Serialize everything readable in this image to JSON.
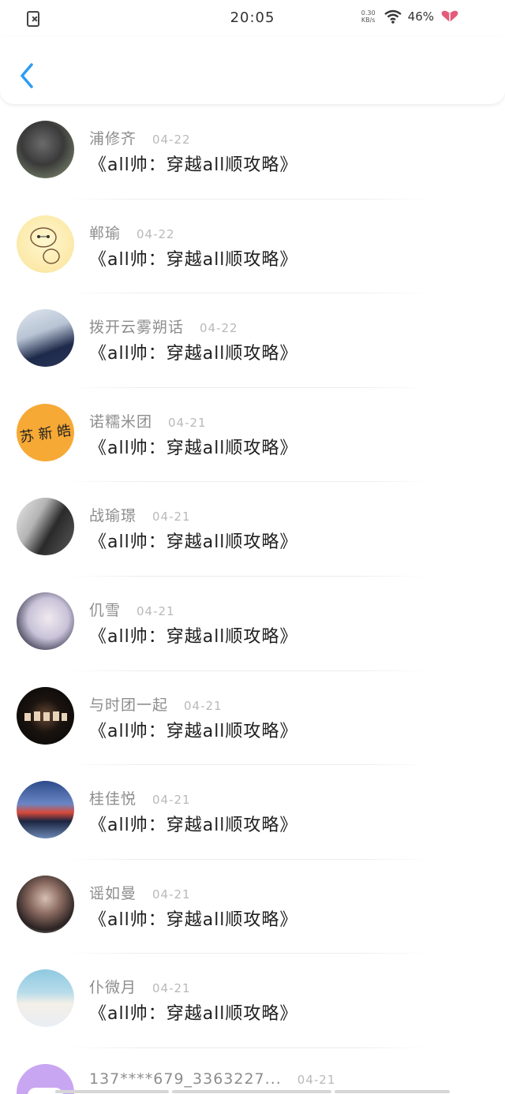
{
  "status_bar": {
    "time": "20:05",
    "net_speed_value": "0.30",
    "net_speed_unit": "KB/s",
    "battery": "46%",
    "left_icon": "close-notification-icon",
    "wifi_icon": "wifi-icon",
    "heart_icon": "heart-icon"
  },
  "nav": {
    "back_icon": "chevron-left-icon",
    "accent_color": "#2d9cf2"
  },
  "items": [
    {
      "username": "浦修齐",
      "date": "04-22",
      "title": "《all帅：穿越all顺攻略》"
    },
    {
      "username": "郸瑜",
      "date": "04-22",
      "title": "《all帅：穿越all顺攻略》"
    },
    {
      "username": "拨开云雾朔话",
      "date": "04-22",
      "title": "《all帅：穿越all顺攻略》"
    },
    {
      "username": "诺糯米团",
      "date": "04-21",
      "title": "《all帅：穿越all顺攻略》",
      "avatar_text": "苏 新 皓"
    },
    {
      "username": "战瑜璟",
      "date": "04-21",
      "title": "《all帅：穿越all顺攻略》"
    },
    {
      "username": "仉雪",
      "date": "04-21",
      "title": "《all帅：穿越all顺攻略》"
    },
    {
      "username": "与时团一起",
      "date": "04-21",
      "title": "《all帅：穿越all顺攻略》"
    },
    {
      "username": "桂佳悦",
      "date": "04-21",
      "title": "《all帅：穿越all顺攻略》"
    },
    {
      "username": "谣如曼",
      "date": "04-21",
      "title": "《all帅：穿越all顺攻略》"
    },
    {
      "username": "仆微月",
      "date": "04-21",
      "title": "《all帅：穿越all顺攻略》"
    },
    {
      "username": "137****679_3363227...",
      "date": "04-21",
      "title": ""
    }
  ]
}
